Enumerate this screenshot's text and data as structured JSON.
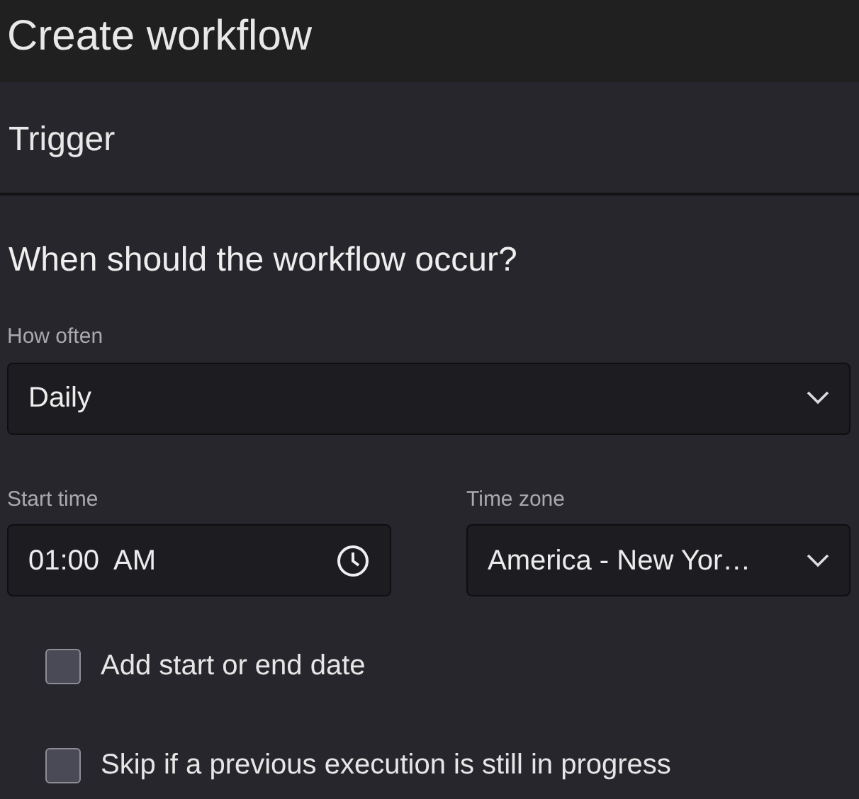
{
  "header": {
    "title": "Create workflow"
  },
  "section": {
    "title": "Trigger"
  },
  "question": "When should the workflow occur?",
  "how_often": {
    "label": "How often",
    "value": "Daily"
  },
  "start_time": {
    "label": "Start time",
    "value": "01:00  AM"
  },
  "time_zone": {
    "label": "Time zone",
    "value": "America - New Yor…"
  },
  "options": [
    {
      "label": "Add start or end date",
      "checked": false
    },
    {
      "label": "Skip if a previous execution is still in progress",
      "checked": false
    }
  ]
}
